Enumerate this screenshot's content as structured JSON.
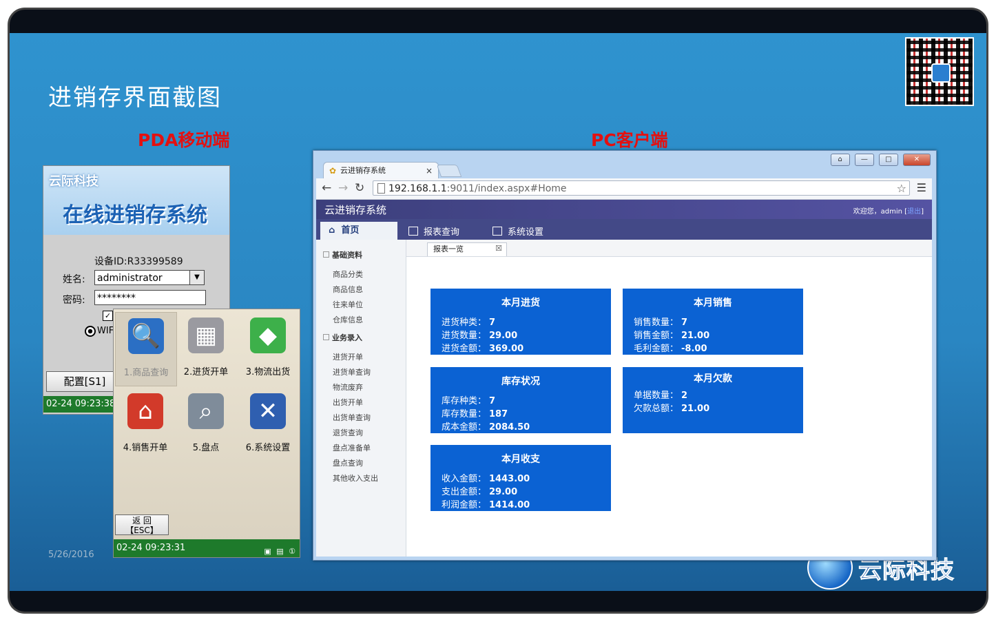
{
  "slide": {
    "title": "进销存界面截图",
    "pda_label": "PDA移动端",
    "pc_label": "PC客户端",
    "date": "5/26/2016",
    "brand": "云际科技"
  },
  "pda_login": {
    "logo": "云际科技",
    "title": "在线进销存系统",
    "device_id": "设备ID:R33399589",
    "name_label": "姓名:",
    "name_value": "administrator",
    "password_label": "密码:",
    "password_value": "********",
    "checkbox": "✓",
    "radio_label": "WIF",
    "config_button": "配置[S1]",
    "status_time": "02-24 09:23:38"
  },
  "pda_menu": {
    "tiles": [
      {
        "label": "1.商品查询",
        "icon": "🔍",
        "color": "#2b6fc4"
      },
      {
        "label": "2.进货开单",
        "icon": "▦",
        "color": "#9a9aa0"
      },
      {
        "label": "3.物流出货",
        "icon": "◆",
        "color": "#3db04a"
      },
      {
        "label": "4.销售开单",
        "icon": "⌂",
        "color": "#d23a2a"
      },
      {
        "label": "5.盘点",
        "icon": "⌕",
        "color": "#7f8c9a"
      },
      {
        "label": "6.系统设置",
        "icon": "✕",
        "color": "#2f5fb0"
      }
    ],
    "back_line1": "返 回",
    "back_line2": "【ESC】",
    "status_time": "02-24 09:23:31",
    "status_icons": "▣ ▤ ①"
  },
  "browser": {
    "tab_title": "云进销存系统",
    "tab_close": "×",
    "url_host": "192.168.1.1",
    "url_rest": ":9011/index.aspx#Home",
    "controls": [
      "⌂",
      "—",
      "□",
      "✕"
    ],
    "app_title": "云进销存系统",
    "welcome_prefix": "欢迎您，admin [",
    "logout": "退出",
    "welcome_suffix": "]",
    "home": "首页",
    "nav": [
      "报表查询",
      "系统设置"
    ],
    "sidebar": {
      "groups": [
        {
          "title": "基础资料",
          "items": [
            "商品分类",
            "商品信息",
            "往来单位",
            "仓库信息"
          ]
        },
        {
          "title": "业务录入",
          "items": [
            "进货开单",
            "进货单查询",
            "物流废弃",
            "出货开单",
            "出货单查询",
            "退货查询",
            "盘点准备单",
            "盘点查询",
            "其他收入支出"
          ]
        }
      ]
    },
    "subtab": "报表一览",
    "cards": [
      {
        "title": "本月进货",
        "rows": [
          [
            "进货种类：",
            "7"
          ],
          [
            "进货数量：",
            "29.00"
          ],
          [
            "进货金额：",
            "369.00"
          ]
        ]
      },
      {
        "title": "本月销售",
        "rows": [
          [
            "销售数量：",
            "7"
          ],
          [
            "销售金额：",
            "21.00"
          ],
          [
            "毛利金额：",
            "-8.00"
          ]
        ]
      },
      {
        "title": "库存状况",
        "rows": [
          [
            "库存种类：",
            "7"
          ],
          [
            "库存数量：",
            "187"
          ],
          [
            "成本金额：",
            "2084.50"
          ]
        ]
      },
      {
        "title": "本月欠款",
        "rows": [
          [
            "单据数量：",
            "2"
          ],
          [
            "欠款总额：",
            "21.00"
          ]
        ]
      },
      {
        "title": "本月收支",
        "rows": [
          [
            "收入金额：",
            "1443.00"
          ],
          [
            "支出金额：",
            "29.00"
          ],
          [
            "利润金额：",
            "1414.00"
          ]
        ]
      }
    ]
  }
}
